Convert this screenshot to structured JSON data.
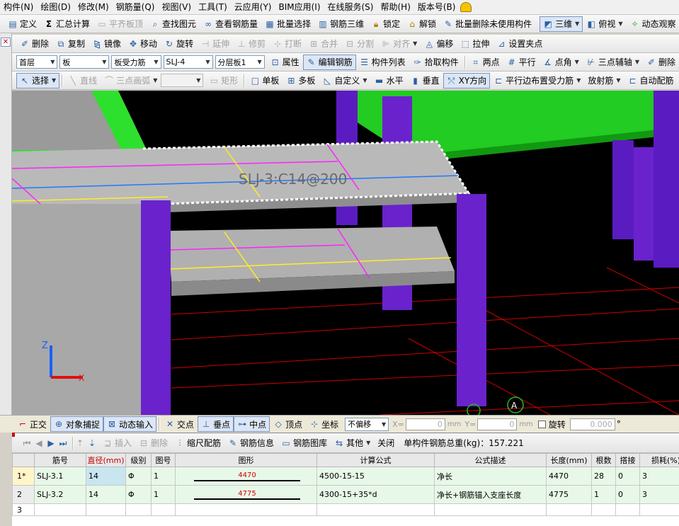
{
  "menu": [
    "构件(N)",
    "绘图(D)",
    "修改(M)",
    "钢筋量(Q)",
    "视图(V)",
    "工具(T)",
    "云应用(Y)",
    "BIM应用(I)",
    "在线服务(S)",
    "帮助(H)",
    "版本号(B)"
  ],
  "toolbar1": {
    "define": "定义",
    "sum": "汇总计算",
    "flat_slab": "平齐板顶",
    "find": "查找图元",
    "view_rebar": "查看钢筋量",
    "batch_select": "批量选择",
    "rebar3d": "钢筋三维",
    "lock": "锁定",
    "unlock": "解锁",
    "batch_delete": "批量删除未使用构件",
    "view3d": "三维",
    "top_view": "俯视",
    "dynamic": "动态观察"
  },
  "toolbar2": {
    "delete": "删除",
    "copy": "复制",
    "mirror": "镜像",
    "move": "移动",
    "rotate": "旋转",
    "extend": "延伸",
    "trim": "修剪",
    "break": "打断",
    "merge": "合并",
    "split": "分割",
    "align": "对齐",
    "offset": "偏移",
    "stretch": "拉伸",
    "set_grip": "设置夹点"
  },
  "toolbar3": {
    "floor": "首层",
    "type": "板",
    "category": "板受力筋",
    "name": "SLJ-4",
    "layer": "分层板1",
    "attr": "属性",
    "edit_rebar": "编辑钢筋",
    "list": "构件列表",
    "pick": "拾取构件",
    "two_point": "两点",
    "parallel": "平行",
    "point_angle": "点角",
    "three_point_axis": "三点辅轴",
    "delete": "删除"
  },
  "toolbar4": {
    "select": "选择",
    "line": "直线",
    "arc": "三点画弧",
    "rect": "矩形",
    "single": "单板",
    "multi": "多板",
    "custom": "自定义",
    "horizontal": "水平",
    "vertical": "垂直",
    "xy": "XY方向",
    "parallel_edge": "平行边布置受力筋",
    "radial": "放射筋",
    "auto": "自动配筋"
  },
  "view": {
    "label": "SLJ-3:C14@200",
    "axis_z": "Z",
    "axis_x": "X",
    "axis_marker": "A"
  },
  "status": {
    "ortho": "正交",
    "snap": "对象捕捉",
    "dynamic_input": "动态输入",
    "intersection": "交点",
    "perp": "垂点",
    "midpoint": "中点",
    "vertex": "顶点",
    "coord": "坐标",
    "offset_mode": "不偏移",
    "x_label": "X=",
    "x_value": "0",
    "y_label": "Y=",
    "y_value": "0",
    "unit": "mm",
    "rotate": "旋转",
    "rotate_value": "0.000",
    "deg": "°"
  },
  "panel": {
    "insert": "插入",
    "delete": "删除",
    "scale": "缩尺配筋",
    "info": "钢筋信息",
    "library": "钢筋图库",
    "other": "其他",
    "close": "关闭",
    "total_label": "单构件钢筋总重(kg)：157.221"
  },
  "table": {
    "headers": [
      "筋号",
      "直径(mm)",
      "级别",
      "图号",
      "图形",
      "计算公式",
      "公式描述",
      "长度(mm)",
      "根数",
      "搭接",
      "损耗(%)"
    ],
    "rows": [
      {
        "rn": "1*",
        "name": "SLJ-3.1",
        "dia": "14",
        "grade": "Φ",
        "fig": "1",
        "shape": "4470",
        "formula": "4500-15-15",
        "desc": "净长",
        "len": "4470",
        "count": "28",
        "lap": "0",
        "loss": "3"
      },
      {
        "rn": "2",
        "name": "SLJ-3.2",
        "dia": "14",
        "grade": "Φ",
        "fig": "1",
        "shape": "4775",
        "formula": "4300-15+35*d",
        "desc": "净长+钢筋锚入支座长度",
        "len": "4775",
        "count": "1",
        "lap": "0",
        "loss": "3"
      }
    ],
    "empty_row": "3"
  }
}
